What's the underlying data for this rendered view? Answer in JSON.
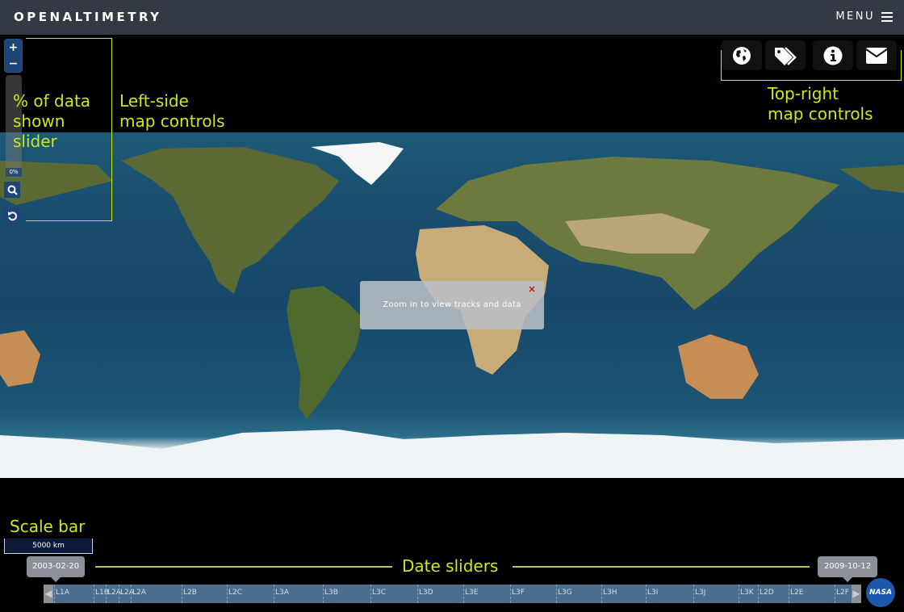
{
  "header": {
    "brand": "OPENALTIMETRY",
    "menu_label": "MENU"
  },
  "map_controls_left": {
    "zoom_in": "+",
    "zoom_out": "−",
    "data_shown_percent": "0%",
    "search_icon": "search-icon",
    "reset_icon": "reset-icon"
  },
  "map_controls_right": [
    {
      "name": "globe-icon",
      "label": "Basemap"
    },
    {
      "name": "tags-icon",
      "label": "Labels"
    },
    {
      "name": "info-icon",
      "label": "Info"
    },
    {
      "name": "envelope-icon",
      "label": "Contact"
    }
  ],
  "popup": {
    "message": "Zoom in to view tracks and data",
    "close": "×"
  },
  "scale_bar": {
    "label": "5000 km"
  },
  "date_slider": {
    "start": "2003-02-20",
    "end": "2009-10-12",
    "campaigns": [
      "L1A",
      "L1B",
      "L2A",
      "L2A",
      "L2A",
      "L2B",
      "L2C",
      "L3A",
      "L3B",
      "L3C",
      "L3D",
      "L3E",
      "L3F",
      "L3G",
      "L3H",
      "L3I",
      "L3J",
      "L3K",
      "L2D",
      "L2E",
      "L2F"
    ]
  },
  "annotations": {
    "pct_slider": "% of data\nshown\nslider",
    "left_controls": "Left-side\nmap controls",
    "top_right": "Top-right\nmap controls",
    "scale_bar": "Scale bar",
    "date_sliders": "Date sliders"
  },
  "logo": {
    "text": "NASA"
  },
  "colors": {
    "annotation": "#c9ea1a",
    "topbar": "#333a44",
    "control_blue": "#1e4578",
    "timeline": "#4b6d8e"
  }
}
